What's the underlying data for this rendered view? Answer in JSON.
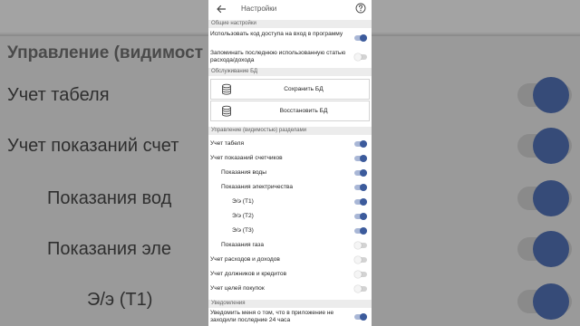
{
  "app_bar": {
    "title": "Настройки",
    "back_icon": "arrow-left-icon",
    "help_icon": "help-circle-icon"
  },
  "sections": {
    "general": "Общие настройки",
    "db": "Обслуживание БД",
    "visibility": "Управление (видимостью) разделами",
    "notifications": "Уведомления"
  },
  "general": {
    "passcode": {
      "label": "Использовать код доступа на вход в программу",
      "on": true
    },
    "remember": {
      "label": "Запоминать последнюю использованную статью расхода/дохода",
      "on": false
    }
  },
  "db": {
    "save_label": "Сохранить БД",
    "restore_label": "Восстановить БД",
    "icon": "database-icon"
  },
  "visibility": [
    {
      "label": "Учет табеля",
      "on": true
    },
    {
      "label": "Учет показаний счетчиков",
      "on": true
    },
    {
      "label": "Показания воды",
      "on": true
    },
    {
      "label": "Показания электричества",
      "on": true
    },
    {
      "label": "Э/э (Т1)",
      "on": true
    },
    {
      "label": "Э/э (Т2)",
      "on": true
    },
    {
      "label": "Э/э (Т3)",
      "on": true
    },
    {
      "label": "Показания газа",
      "on": false
    },
    {
      "label": "Учет расходов и доходов",
      "on": false
    },
    {
      "label": "Учет должников и кредитов",
      "on": false
    },
    {
      "label": "Учет целей покупок",
      "on": false
    }
  ],
  "notifications": {
    "inactivity": {
      "label": "Уведомить меня о том, что в приложение не заходили последние 24 часа",
      "on": true
    }
  },
  "background": {
    "header": "Управление (видимост",
    "rows": [
      "Учет табеля",
      "Учет показаний счет",
      "Показания вод",
      "Показания эле",
      "Э/э (Т1)"
    ]
  },
  "colors": {
    "accent": "#3c5b9c",
    "toggle_on_track": "#a9b7d6",
    "toggle_off_track": "#d3d3d3",
    "section_bg": "#ececec"
  }
}
